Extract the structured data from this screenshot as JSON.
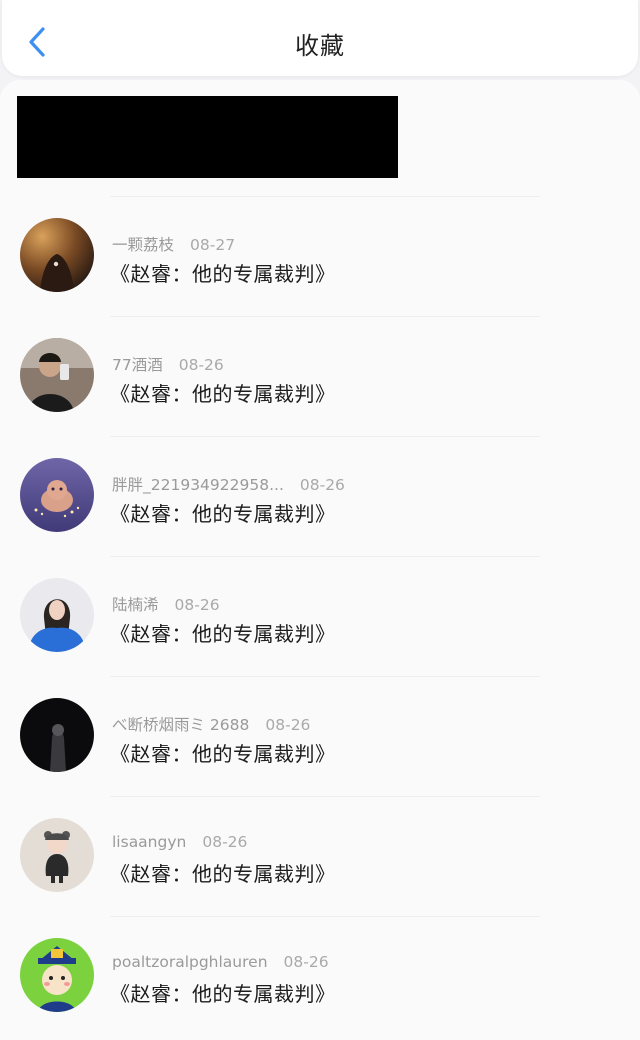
{
  "header": {
    "title": "收藏"
  },
  "items": [
    {
      "user": "一颗荔枝",
      "date": "08-27",
      "title": "《赵睿：他的专属裁判》",
      "avatar": "avatar-dark-necklace"
    },
    {
      "user": "77酒酒",
      "date": "08-26",
      "title": "《赵睿：他的专属裁判》",
      "avatar": "avatar-mirror-selfie"
    },
    {
      "user": "胖胖_221934922958...",
      "date": "08-26",
      "title": "《赵睿：他的专属裁判》",
      "avatar": "avatar-purple-cat"
    },
    {
      "user": "陆楠浠",
      "date": "08-26",
      "title": "《赵睿：他的专属裁判》",
      "avatar": "avatar-blue-jacket-girl"
    },
    {
      "user": "べ断桥烟雨ミ 2688",
      "date": "08-26",
      "title": "《赵睿：他的专属裁判》",
      "avatar": "avatar-dark-figure"
    },
    {
      "user": "lisaangyn",
      "date": "08-26",
      "title": "《赵睿：他的专属裁判》",
      "avatar": "avatar-toddler"
    },
    {
      "user": "poaltzoralpghlauren",
      "date": "08-26",
      "title": "《赵睿：他的专属裁判》",
      "avatar": "avatar-cartoon-official"
    }
  ],
  "colors": {
    "accent": "#3d8ff0",
    "background": "#f3f3f5"
  },
  "icons": {
    "back": "chevron-left-icon"
  }
}
